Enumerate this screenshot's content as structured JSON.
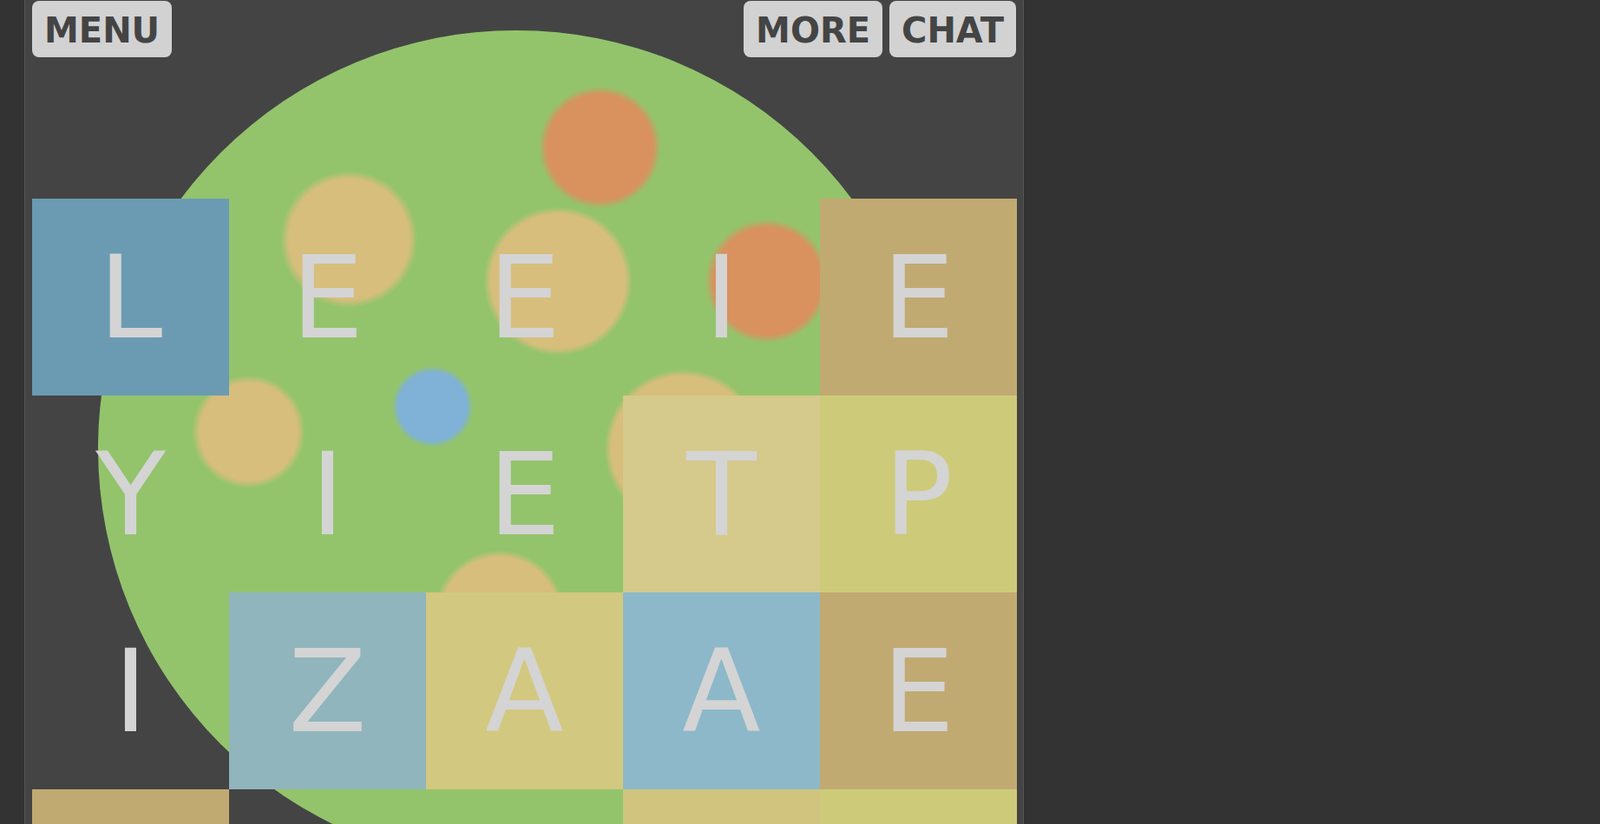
{
  "buttons": [
    {
      "label": "MENU",
      "side": "left"
    },
    {
      "label": "MORE",
      "side": "right"
    },
    {
      "label": "CHAT",
      "side": "right"
    }
  ],
  "board": {
    "rows": [
      [
        {
          "letter": "L",
          "color": "#6b9bb2"
        },
        {
          "letter": "E",
          "color": null
        },
        {
          "letter": "E",
          "color": null
        },
        {
          "letter": "I",
          "color": null
        },
        {
          "letter": "E",
          "color": "#c1aa72"
        }
      ],
      [
        {
          "letter": "Y",
          "color": null
        },
        {
          "letter": "I",
          "color": null
        },
        {
          "letter": "E",
          "color": null
        },
        {
          "letter": "T",
          "color": "#d5c98b"
        },
        {
          "letter": "P",
          "color": "#cdcb7a"
        }
      ],
      [
        {
          "letter": "I",
          "color": null
        },
        {
          "letter": "Z",
          "color": "#90b5bd"
        },
        {
          "letter": "A",
          "color": "#d3c87f"
        },
        {
          "letter": "A",
          "color": "#8db8c9"
        },
        {
          "letter": "E",
          "color": "#c1aa72"
        }
      ],
      [
        {
          "letter": "",
          "color": "#c1aa72"
        },
        {
          "letter": "",
          "color": null
        },
        {
          "letter": "",
          "color": null
        },
        {
          "letter": "",
          "color": "#d0c47e"
        },
        {
          "letter": "",
          "color": "#cdcb7a"
        }
      ]
    ]
  }
}
